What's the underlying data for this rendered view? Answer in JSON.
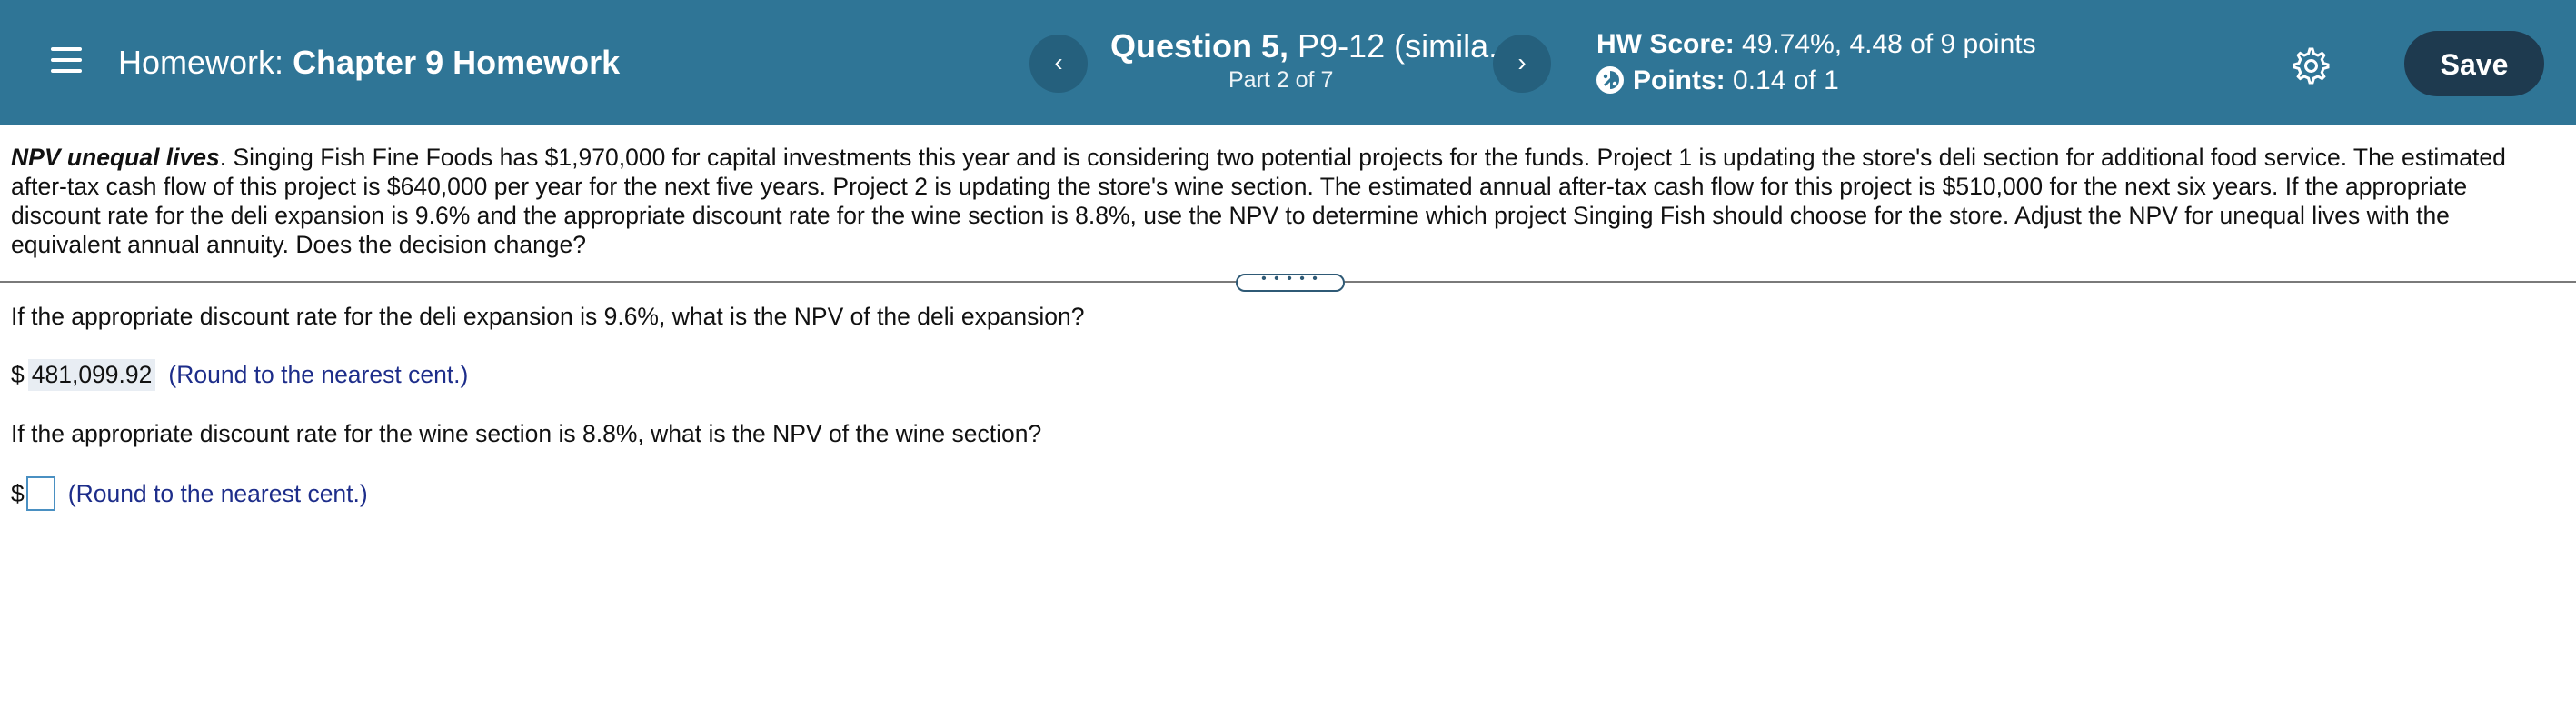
{
  "header": {
    "hw_prefix": "Homework:",
    "hw_name": "Chapter 9 Homework",
    "question_label": "Question 5,",
    "question_ref": " P9-12 (simila...",
    "part": "Part 2 of 7",
    "score_label": "HW Score:",
    "score_value": " 49.74%, 4.48 of 9 points",
    "points_label": "Points:",
    "points_value": " 0.14 of 1",
    "save_label": "Save",
    "prev_glyph": "‹",
    "next_glyph": "›"
  },
  "problem": {
    "lead": "NPV unequal lives",
    "text": ". Singing Fish Fine Foods has $1,970,000 for capital investments this year and is considering two potential projects for the funds. Project 1 is updating the store's deli section for additional food service. The estimated after-tax cash flow of this project is $640,000 per year for the next five years. Project 2 is updating the store's wine section. The estimated annual after-tax cash flow for this project is $510,000 for the next six years. If the appropriate discount rate for the deli expansion is 9.6% and the appropriate discount rate for the wine section is 8.8%, use the NPV to determine which project Singing Fish should choose for the store. Adjust the NPV for unequal lives with the equivalent annual annuity. Does the decision change?"
  },
  "divider_handle": "• • • • •",
  "questions": [
    {
      "text": "If the appropriate discount rate for the deli expansion is 9.6%, what is the NPV of the deli expansion?",
      "currency": "$",
      "answer": "481,099.92",
      "hint": "(Round to the nearest cent.)"
    },
    {
      "text": "If the appropriate discount rate for the wine section is 8.8%, what is the NPV of the wine section?",
      "currency": "$",
      "answer": "",
      "hint": "(Round to the nearest cent.)"
    }
  ],
  "icons": {
    "menu": "menu-icon",
    "prev": "chevron-left-icon",
    "next": "chevron-right-icon",
    "points": "partial-credit-icon",
    "settings": "gear-icon"
  },
  "colors": {
    "header_bg": "#2f7596",
    "save_bg": "#1e3a4f",
    "hint_text": "#1d2d8a",
    "input_border": "#4a90c2"
  }
}
